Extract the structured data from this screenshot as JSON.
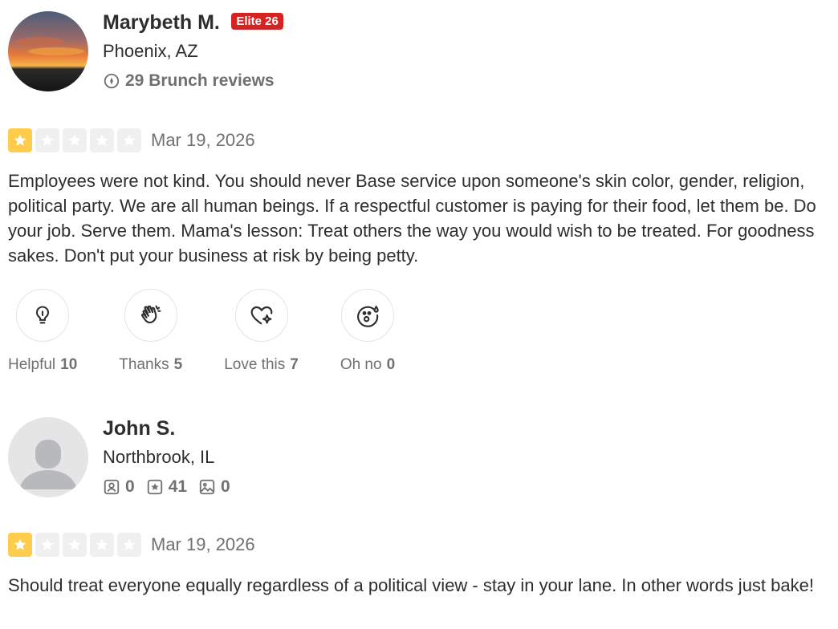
{
  "reviews": [
    {
      "user": {
        "name": "Marybeth M.",
        "elite_badge": "Elite 26",
        "location": "Phoenix, AZ",
        "stats_text": "29 Brunch reviews"
      },
      "rating": 1,
      "rating_max": 5,
      "date": "Mar 19, 2026",
      "text": "Employees were not kind. You should never Base service upon someone's skin color, gender, religion, political party. We are all human beings. If a respectful customer is paying for their food, let them be. Do your job. Serve them. Mama's lesson: Treat others the way you would wish to be treated. For goodness sakes. Don't put your business at risk by being petty.",
      "reactions": [
        {
          "label": "Helpful",
          "count": "10",
          "icon": "lightbulb-icon"
        },
        {
          "label": "Thanks",
          "count": "5",
          "icon": "clapping-hands-icon"
        },
        {
          "label": "Love this",
          "count": "7",
          "icon": "heart-sparkle-icon"
        },
        {
          "label": "Oh no",
          "count": "0",
          "icon": "surprised-face-icon"
        }
      ]
    },
    {
      "user": {
        "name": "John S.",
        "location": "Northbrook, IL",
        "friends": "0",
        "reviews": "41",
        "photos": "0"
      },
      "rating": 1,
      "rating_max": 5,
      "date": "Mar 19, 2026",
      "text": "Should treat everyone equally regardless of a political view - stay in your lane. In other words just bake!"
    }
  ],
  "colors": {
    "elite_red": "#d32323",
    "star_on": "#ffcc4b",
    "star_off": "#f0f0f0",
    "muted_text": "#6e7072"
  }
}
